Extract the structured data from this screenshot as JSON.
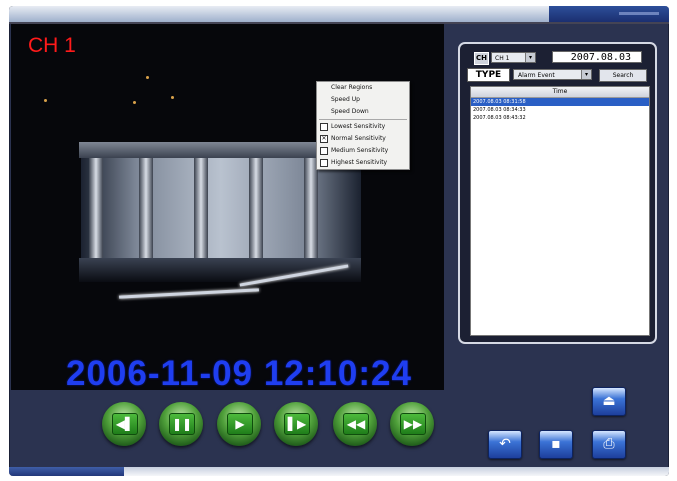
{
  "video": {
    "channel_label": "CH 1",
    "timestamp": "2006-11-09 12:10:24"
  },
  "context_menu": {
    "items": [
      {
        "label": "Clear Regions",
        "type": "action"
      },
      {
        "label": "Speed Up",
        "type": "action"
      },
      {
        "label": "Speed Down",
        "type": "action"
      },
      {
        "label": "Lowest Sensitivity",
        "type": "check",
        "checked": false
      },
      {
        "label": "Normal Sensitivity",
        "type": "check",
        "checked": true
      },
      {
        "label": "Medium Sensitivity",
        "type": "check",
        "checked": false
      },
      {
        "label": "Highest Sensitivity",
        "type": "check",
        "checked": false
      }
    ]
  },
  "search_panel": {
    "ch_label": "CH",
    "channel_value": "CH 1",
    "date_value": "2007.08.03",
    "type_label": "TYPE",
    "type_value": "Alarm Event",
    "search_button": "Search",
    "list_header": "Time",
    "rows": [
      "2007.08.03 08:31:58",
      "2007.08.03 08:34:33",
      "2007.08.03 08:43:32"
    ]
  },
  "controls": {
    "icons": [
      "step-back-icon",
      "pause-icon",
      "play-icon",
      "step-forward-icon",
      "rewind-icon",
      "fast-forward-icon"
    ]
  },
  "side_buttons": {
    "icons": [
      "eject-icon",
      "undo-icon",
      "save-icon",
      "print-icon"
    ]
  },
  "colors": {
    "channel_label": "#ff1a1a",
    "timestamp": "#1f3ef0",
    "frame": "#2b3350",
    "selection": "#2a5fc5"
  }
}
